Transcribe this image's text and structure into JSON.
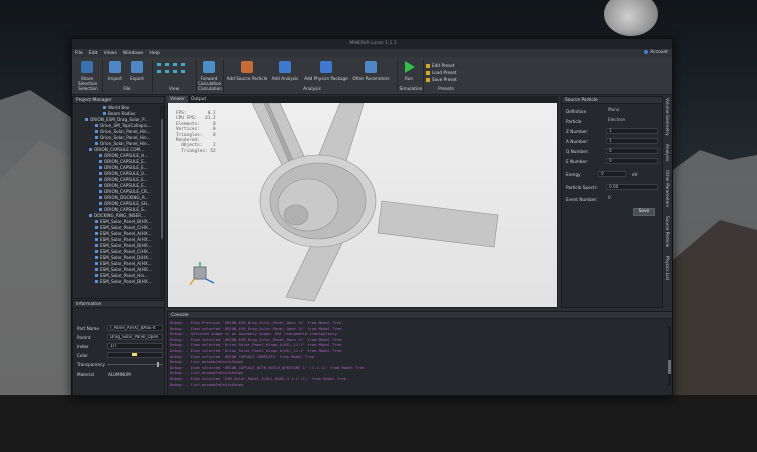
{
  "window": {
    "title": "MINERVA Lunar 1.1.1",
    "account_label": "Account"
  },
  "menu": [
    "File",
    "Edit",
    "Views",
    "Windows",
    "Help"
  ],
  "toolbar": {
    "share": "Share\nSelection",
    "import": "Import",
    "export": "Export",
    "forward": "Forward\nCalculation",
    "add_source": "Add Source Particle",
    "add_analysis": "Add Analysis",
    "add_physics": "Add Physics Package",
    "other_params": "Other Parameters",
    "run": "Run",
    "groups": {
      "selection": "Selection",
      "file": "File",
      "view": "View",
      "calculation": "Calculation",
      "analysis": "Analysis",
      "simulation": "Simulation",
      "presets": "Presets"
    },
    "presets": [
      "Edit Preset",
      "Load Preset",
      "Save Preset"
    ]
  },
  "project_manager": {
    "title": "Project Manager",
    "items": [
      "World Box",
      "Beam Radius",
      "ORION_ESM_Drag_Solar_P...",
      "Orion_SM_Top(Collapsi...",
      "Orion_Solar_Panel_Hin...",
      "Orion_Solar_Panel_Hin...",
      "Orion_Solar_Panel_Hin...",
      "ORION_CAPSULE COM...",
      "ORION_CAPSULE_H...",
      "ORION_CAPSULE_E...",
      "ORION_CAPSULE_E...",
      "ORION_CAPSULE_0...",
      "ORION_CAPSULE_E...",
      "ORION_CAPSULE_E...",
      "ORION_CAPSULE_CR...",
      "ORION_DOCKING_R...",
      "ORION_CAPSULE_SH...",
      "ORION_CAPSULE_S...",
      "DOCKING_RING_INSER...",
      "ESM_Solar_Panel_B(HX...",
      "ESM_Solar_Panel_C(HX...",
      "ESM_Solar_Panel_A(HX...",
      "ESM_Solar_Panel_A(HX...",
      "ESM_Solar_Panel_B(HX...",
      "ESM_Solar_Panel_C(HX...",
      "ESM_Solar_Panel_D(HX...",
      "ESM_Solar_Panel_A(HX...",
      "ESM_Solar_Panel_A(HX...",
      "ESM_Solar_Panel_Hin...",
      "ESM_Solar_Panel_B(HX..."
    ]
  },
  "viewer": {
    "tabs": [
      "Viewer",
      "Output"
    ],
    "stats": [
      "FPS:        0.1",
      "CPU FPS:   41.2",
      "Elements:     0",
      "Vertices:     0",
      "Triangles:    0",
      "Rendered:",
      "  Objects:    2",
      "  Triangles: 52"
    ]
  },
  "source_particle": {
    "title": "Source Particle",
    "rows": [
      {
        "label": "Definition",
        "value": "Mono"
      },
      {
        "label": "Particle",
        "value": "Electron"
      },
      {
        "label": "Z Number:",
        "value": "1"
      },
      {
        "label": "A Number:",
        "value": "1"
      },
      {
        "label": "Q Number:",
        "value": "0"
      },
      {
        "label": "E Number:",
        "value": "0"
      },
      {
        "label": "Energy",
        "value": "0"
      },
      {
        "label": "Particle Spectr:",
        "value": "0.00"
      },
      {
        "label": "Event Number:",
        "value": "0"
      }
    ],
    "energy_unit": "eV",
    "save_label": "Save"
  },
  "side_tabs": [
    "Volume Geometry",
    "Analysis",
    "Other Parameters",
    "Source Particle",
    "Physics List"
  ],
  "information": {
    "title": "Information",
    "rows": [
      {
        "label": "Part Name",
        "value": "r_Panel_A(HX)_BASE-4"
      },
      {
        "label": "Parent",
        "value": "Drag_Solar_Panel_Open"
      },
      {
        "label": "Index",
        "value": "1/7"
      },
      {
        "label": "Color",
        "value": ""
      },
      {
        "label": "Transparency",
        "value": ""
      },
      {
        "label": "Material",
        "value": "ALUMINUM"
      }
    ],
    "color_swatch": "#f0e070"
  },
  "console": {
    "title": "Console",
    "lines": [
      "Debug: - Item Previous 'ORION_ESM_Drag_Solar_Panel_Open 11' from Model Tree.",
      "Debug: - Item selected 'ORION_ESM_Drag_Solar_Panel_Open 11' from Model Tree.",
      "Debug: - Selected shape is an assembly shape. Not changeable transparency.",
      "Debug: - Item selected 'ORION_ESM_Drag_Solar_Panel_Open 11' from Model Tree.",
      "Debug: - Item selected 'Orion_Solar_Panel_Hinge_A(HX)_11:1' from Model Tree.",
      "Debug: - Item selected 'Orion_Solar_Panel_Hinge_A(HX)_11:1' from Model Tree.",
      "Debug: - Item selected 'ORION CAPSULE COMPLETE' from Model Tree.",
      "Debug: - list_assembleUnitsShape",
      "Debug: - Item selected 'ORION_CAPSULE_WITH_NOTCH_APERTURE 1' (1.1.1)' from Model Tree.",
      "Debug: - list_assembleUnitsShape",
      "Debug: - Item selected 'ESM_Solar_Panel_A(HX)_BASE-4 1:1'(1)' from Model Tree.",
      "Debug: - list_assembleUnitsShape"
    ]
  }
}
